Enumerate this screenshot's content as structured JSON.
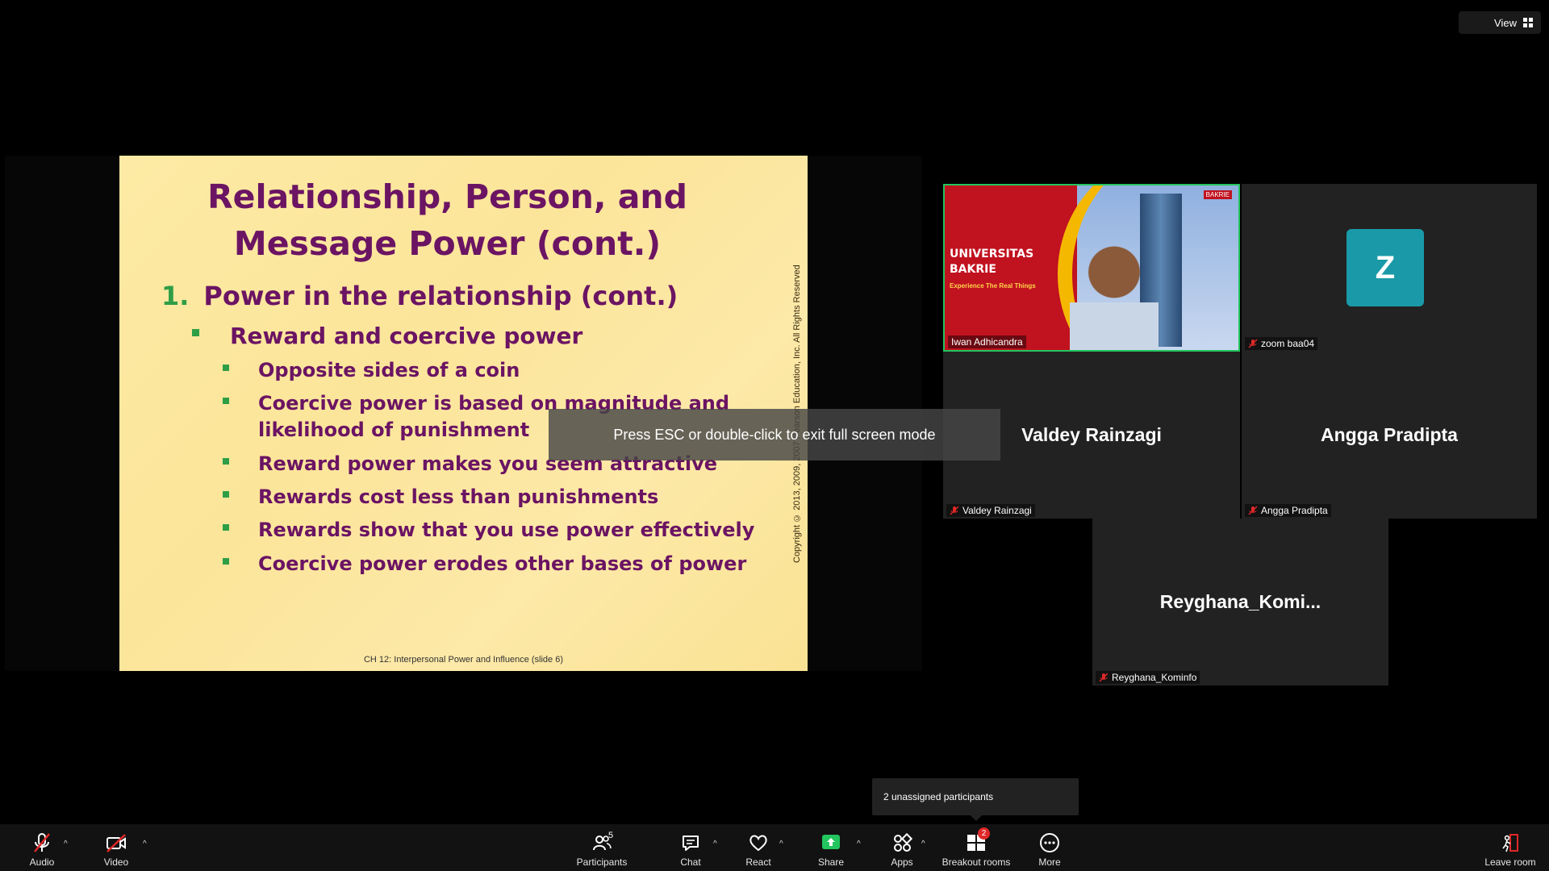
{
  "topbar": {
    "view_label": "View"
  },
  "slide": {
    "title_line1": "Relationship, Person, and",
    "title_line2": "Message Power (cont.)",
    "level1_num": "1.",
    "level1_text": "Power in the relationship (cont.)",
    "level2_text": "Reward and coercive power",
    "bullets": [
      "Opposite sides of a coin",
      "Coercive power is based on magnitude and",
      "likelihood of punishment",
      "Reward power makes you seem attractive",
      "Rewards cost less than punishments",
      "Rewards show that you use power effectively",
      "Coercive power erodes other bases of power"
    ],
    "copyright": "Copyright © 2013, 2009, 2007 Pearson Education, Inc. All Rights Reserved",
    "footer": "CH 12: Interpersonal Power and Influence (slide 6)"
  },
  "overlay": {
    "esc_text": "Press ESC or double-click to exit full screen mode"
  },
  "tiles": {
    "active": {
      "label": "Iwan Adhicandra",
      "bg_title1": "UNIVERSITAS",
      "bg_title2": "BAKRIE",
      "bg_sub": "Experience The Real Things",
      "bg_logo": "BAKRIE"
    },
    "zoom": {
      "avatar": "Z",
      "label": "zoom baa04"
    },
    "valdey": {
      "name": "Valdey Rainzagi",
      "label": "Valdey Rainzagi"
    },
    "angga": {
      "name": "Angga Pradipta",
      "label": "Angga Pradipta"
    },
    "reyghana": {
      "name": "Reyghana_Komi...",
      "label": "Reyghana_Kominfo"
    }
  },
  "tooltip": {
    "text": "2 unassigned participants"
  },
  "toolbar": {
    "audio": "Audio",
    "video": "Video",
    "participants": "Participants",
    "participants_count": "5",
    "chat": "Chat",
    "react": "React",
    "share": "Share",
    "apps": "Apps",
    "breakout": "Breakout rooms",
    "breakout_badge": "2",
    "more": "More",
    "leave": "Leave room"
  },
  "colors": {
    "accent_green": "#23c55e",
    "share_green": "#22c55e",
    "muted_red": "#e02828",
    "slide_text": "#6b1463",
    "bullet_green": "#2e9e46"
  }
}
